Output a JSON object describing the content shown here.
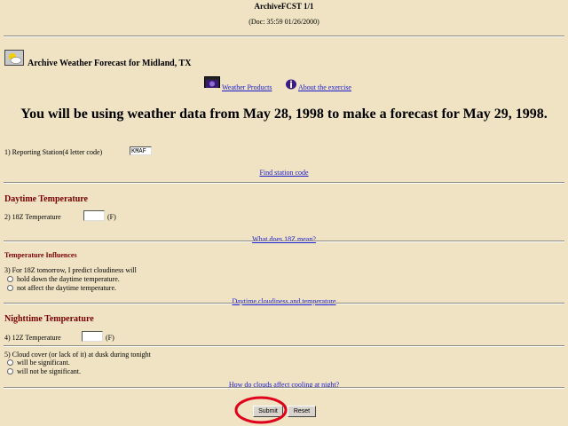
{
  "page": {
    "title": "ArchiveFCST 1/1",
    "subtitle": "(Doc: 35:59 01/26/2000)"
  },
  "header": {
    "heading": "Archive Weather Forecast for Midland, TX",
    "nav_weather_products": "Weather Products",
    "nav_about_exercise": "About the exercise",
    "main_message": "You will be using weather data from May 28, 1998 to make a forecast for May 29, 1998."
  },
  "q1": {
    "label": "1) Reporting Station(4 letter code)",
    "value": "KMAF",
    "link": "Find station code"
  },
  "daytime": {
    "heading": "Daytime Temperature",
    "q2_label": "2) 18Z Temperature",
    "unit": "(F)",
    "link": "What does 18Z mean?"
  },
  "influences": {
    "heading": "Temperature Influences",
    "q3_label": "3) For 18Z tomorrow, I predict cloudiness will",
    "options": [
      "hold down the daytime temperature.",
      "not affect the daytime temperature."
    ],
    "link": "Daytime cloudiness and temperature"
  },
  "nighttime": {
    "heading": "Nighttime Temperature",
    "q4_label": "4) 12Z Temperature",
    "unit": "(F)",
    "q5_label": "5) Cloud cover (or lack of it) at dusk during tonight",
    "options": [
      "will be significant.",
      "will not be significant."
    ],
    "link": "How do clouds affect cooling at night?"
  },
  "buttons": {
    "submit": "Submit",
    "reset": "Reset"
  },
  "colors": {
    "background": "#efe3c4",
    "section_heading": "#7a0000",
    "link": "#1a1acc",
    "highlight_circle": "#e0001a"
  }
}
